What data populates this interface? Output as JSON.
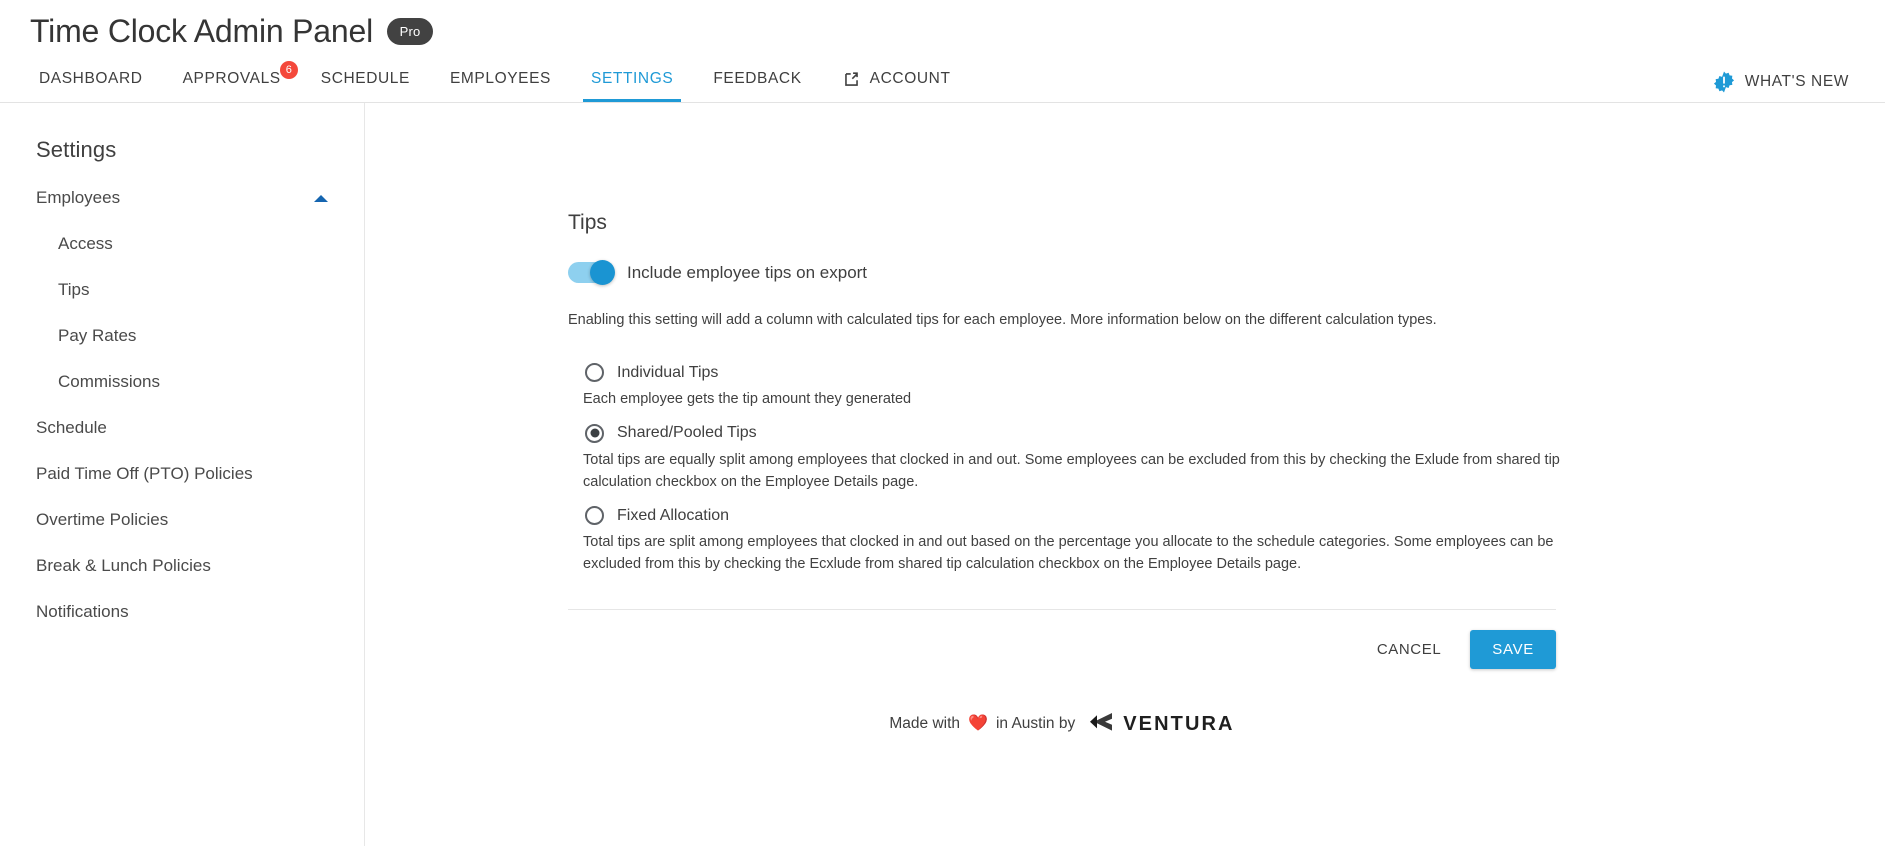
{
  "header": {
    "app_title": "Time Clock Admin Panel",
    "plan_badge": "Pro",
    "tabs": [
      {
        "label": "DASHBOARD",
        "active": false,
        "badge": null,
        "icon": null
      },
      {
        "label": "APPROVALS",
        "active": false,
        "badge": "6",
        "icon": null
      },
      {
        "label": "SCHEDULE",
        "active": false,
        "badge": null,
        "icon": null
      },
      {
        "label": "EMPLOYEES",
        "active": false,
        "badge": null,
        "icon": null
      },
      {
        "label": "SETTINGS",
        "active": true,
        "badge": null,
        "icon": null
      },
      {
        "label": "FEEDBACK",
        "active": false,
        "badge": null,
        "icon": null
      },
      {
        "label": "ACCOUNT",
        "active": false,
        "badge": null,
        "icon": "external-link-icon"
      }
    ],
    "whats_new": {
      "label": "WHAT'S NEW",
      "icon": "alert-burst-icon"
    }
  },
  "sidebar": {
    "title": "Settings",
    "group": {
      "label": "Employees",
      "expanded": true,
      "caret_icon": "caret-up-icon",
      "children": [
        {
          "label": "Access"
        },
        {
          "label": "Tips"
        },
        {
          "label": "Pay Rates"
        },
        {
          "label": "Commissions"
        }
      ]
    },
    "items": [
      {
        "label": "Schedule"
      },
      {
        "label": "Paid Time Off (PTO) Policies"
      },
      {
        "label": "Overtime Policies"
      },
      {
        "label": "Break & Lunch Policies"
      },
      {
        "label": "Notifications"
      }
    ]
  },
  "main": {
    "title": "Tips",
    "toggle": {
      "label": "Include employee tips on export",
      "state": "on"
    },
    "intro": "Enabling this setting will add a column with calculated tips for each employee. More information below on the different calculation types.",
    "options": [
      {
        "label": "Individual Tips",
        "selected": false,
        "description": "Each employee gets the tip amount they generated"
      },
      {
        "label": "Shared/Pooled Tips",
        "selected": true,
        "description": "Total tips are equally split among employees that clocked in and out. Some employees can be excluded from this by checking the Exlude from shared tip calculation checkbox on the Employee Details page."
      },
      {
        "label": "Fixed Allocation",
        "selected": false,
        "description": "Total tips are split among employees that clocked in and out based on the percentage you allocate to the schedule categories. Some employees can be excluded from this by checking the Ecxlude from shared tip calculation checkbox on the Employee Details page."
      }
    ],
    "actions": {
      "cancel_label": "CANCEL",
      "save_label": "SAVE"
    }
  },
  "footer": {
    "made_with": "Made with",
    "heart": "❤️",
    "in_city_by": "in Austin by",
    "brand": "VENTURA"
  },
  "colors": {
    "accent_blue": "#1f9ad6",
    "badge_red": "#f4483b",
    "pro_dark": "#424242",
    "caret_blue": "#1565b0",
    "toggle_track": "#8ed0ef",
    "toggle_knob": "#1a94d2"
  }
}
